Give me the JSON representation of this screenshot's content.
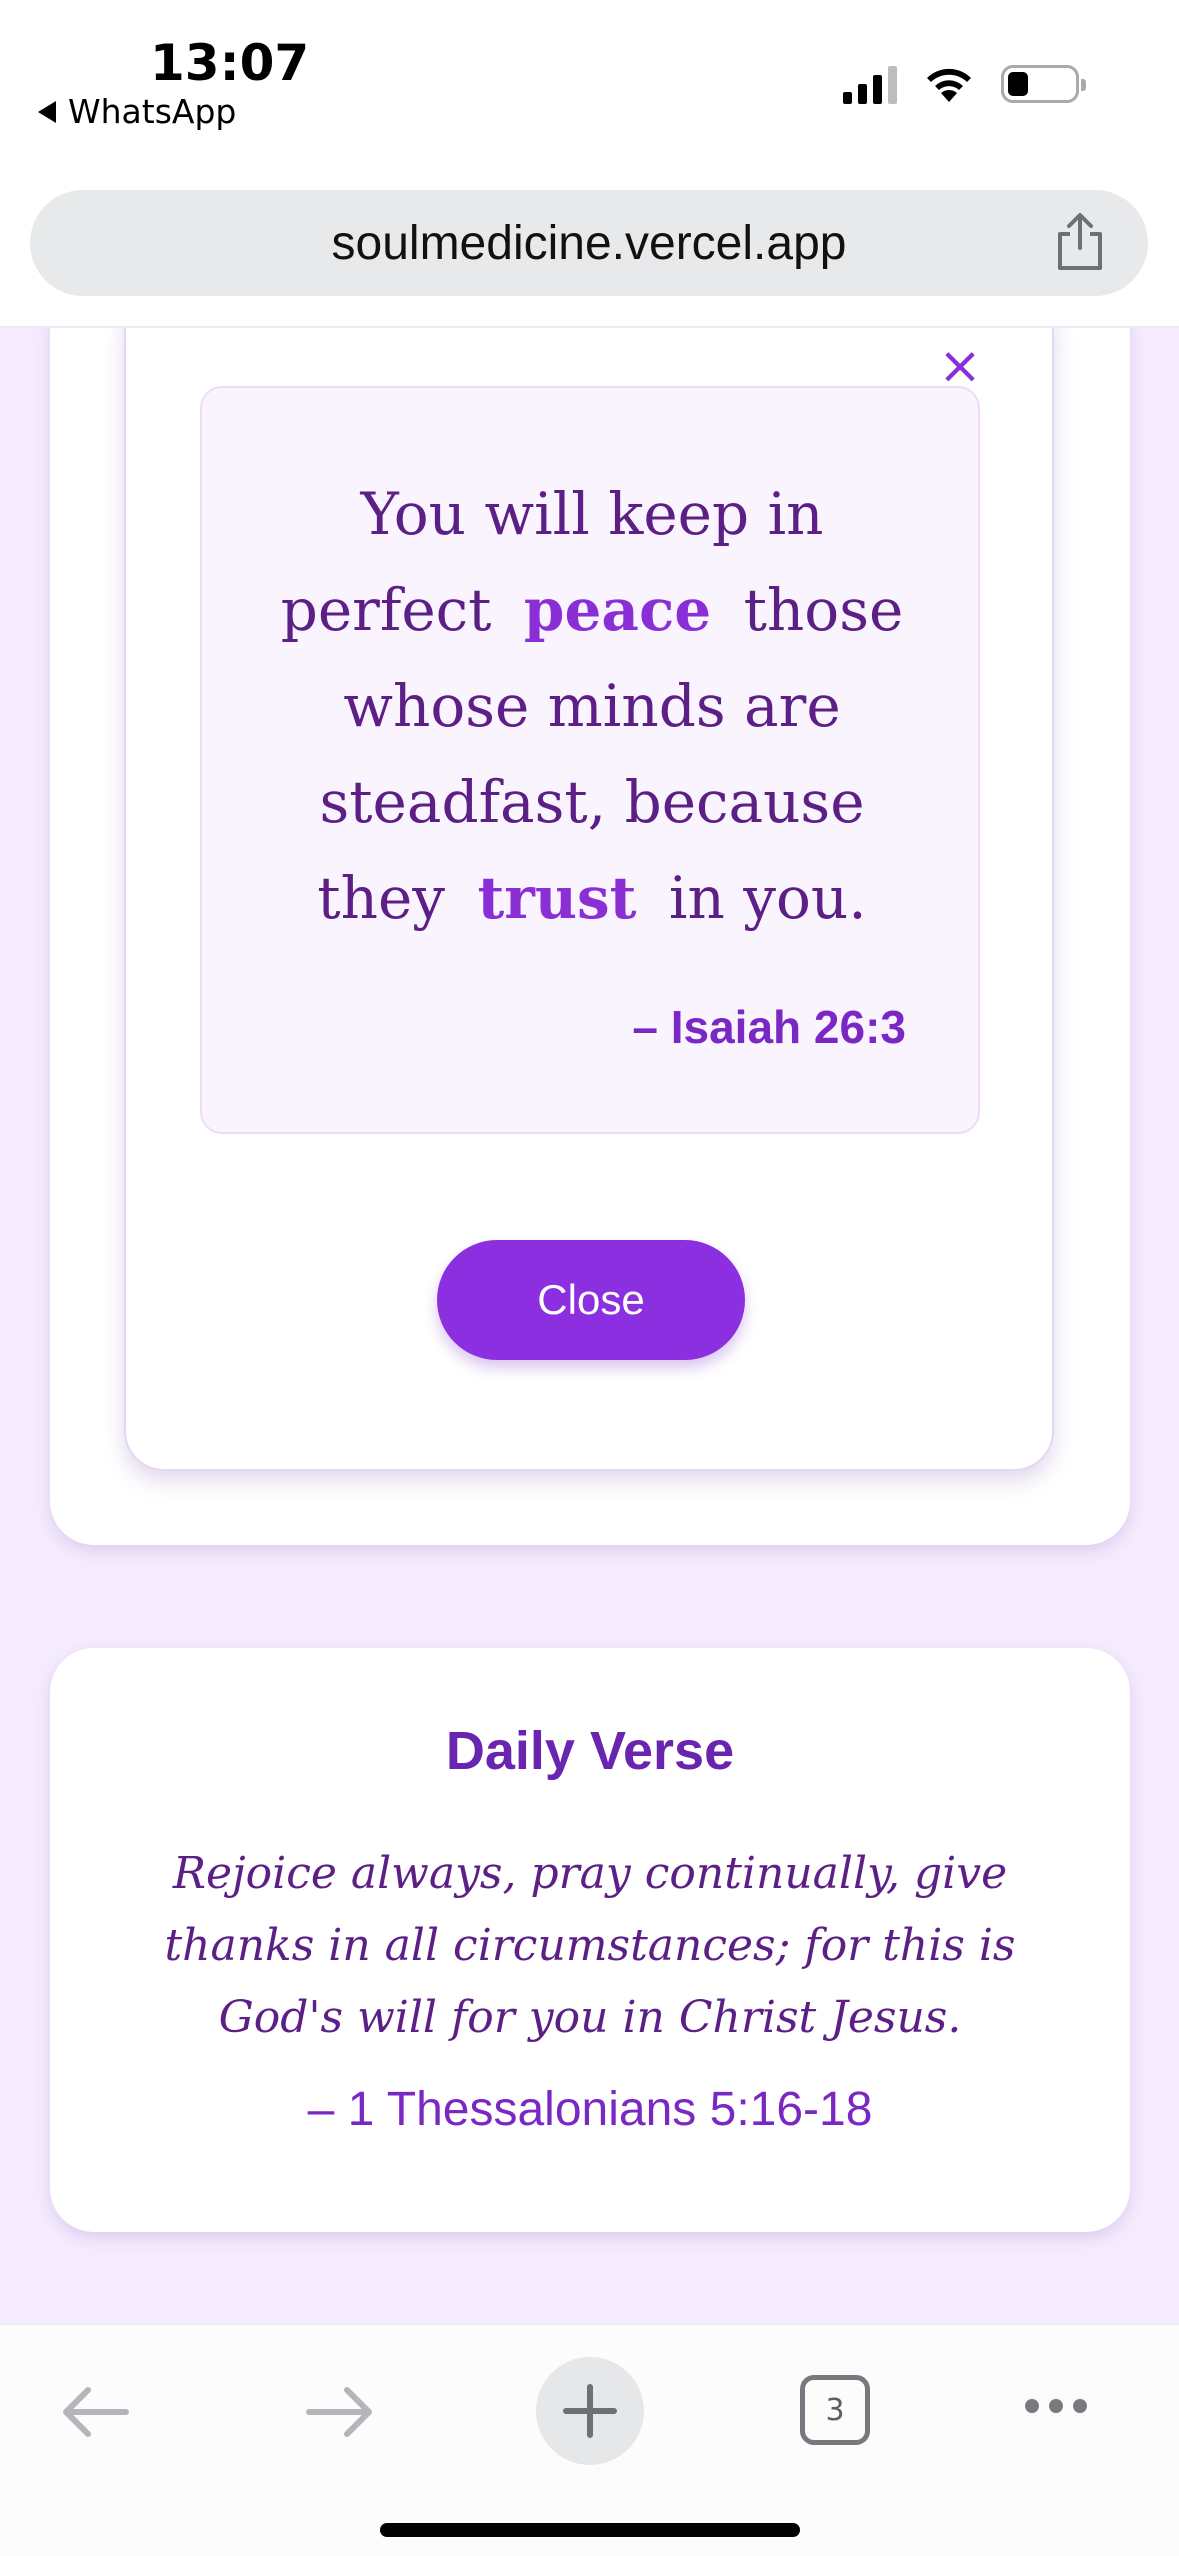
{
  "status_bar": {
    "time": "13:07",
    "back_app": "WhatsApp",
    "icons": [
      "signal-icon",
      "wifi-icon",
      "battery-icon"
    ]
  },
  "browser": {
    "url": "soulmedicine.vercel.app",
    "share_icon": "share-icon"
  },
  "modal": {
    "close_icon": "×",
    "verse": {
      "part1": "You will keep in perfect",
      "highlight1": "peace",
      "part2": "those whose minds are steadfast, because they",
      "highlight2": "trust",
      "part3": "in you."
    },
    "reference": "– Isaiah 26:3",
    "close_button": "Close"
  },
  "daily_verse": {
    "title": "Daily Verse",
    "text": "Rejoice always, pray continually, give thanks in all circumstances; for this is God's will for you in Christ Jesus.",
    "reference": "– 1 Thessalonians 5:16-18"
  },
  "toolbar": {
    "tab_count": "3",
    "icons": [
      "back-arrow-icon",
      "forward-arrow-icon",
      "plus-icon",
      "tabs-icon",
      "more-icon"
    ]
  },
  "colors": {
    "accent": "#8b2fe0",
    "text_purple": "#5b1f86",
    "page_background": "#f4ebfe",
    "verse_box_background": "#faf4fe"
  }
}
